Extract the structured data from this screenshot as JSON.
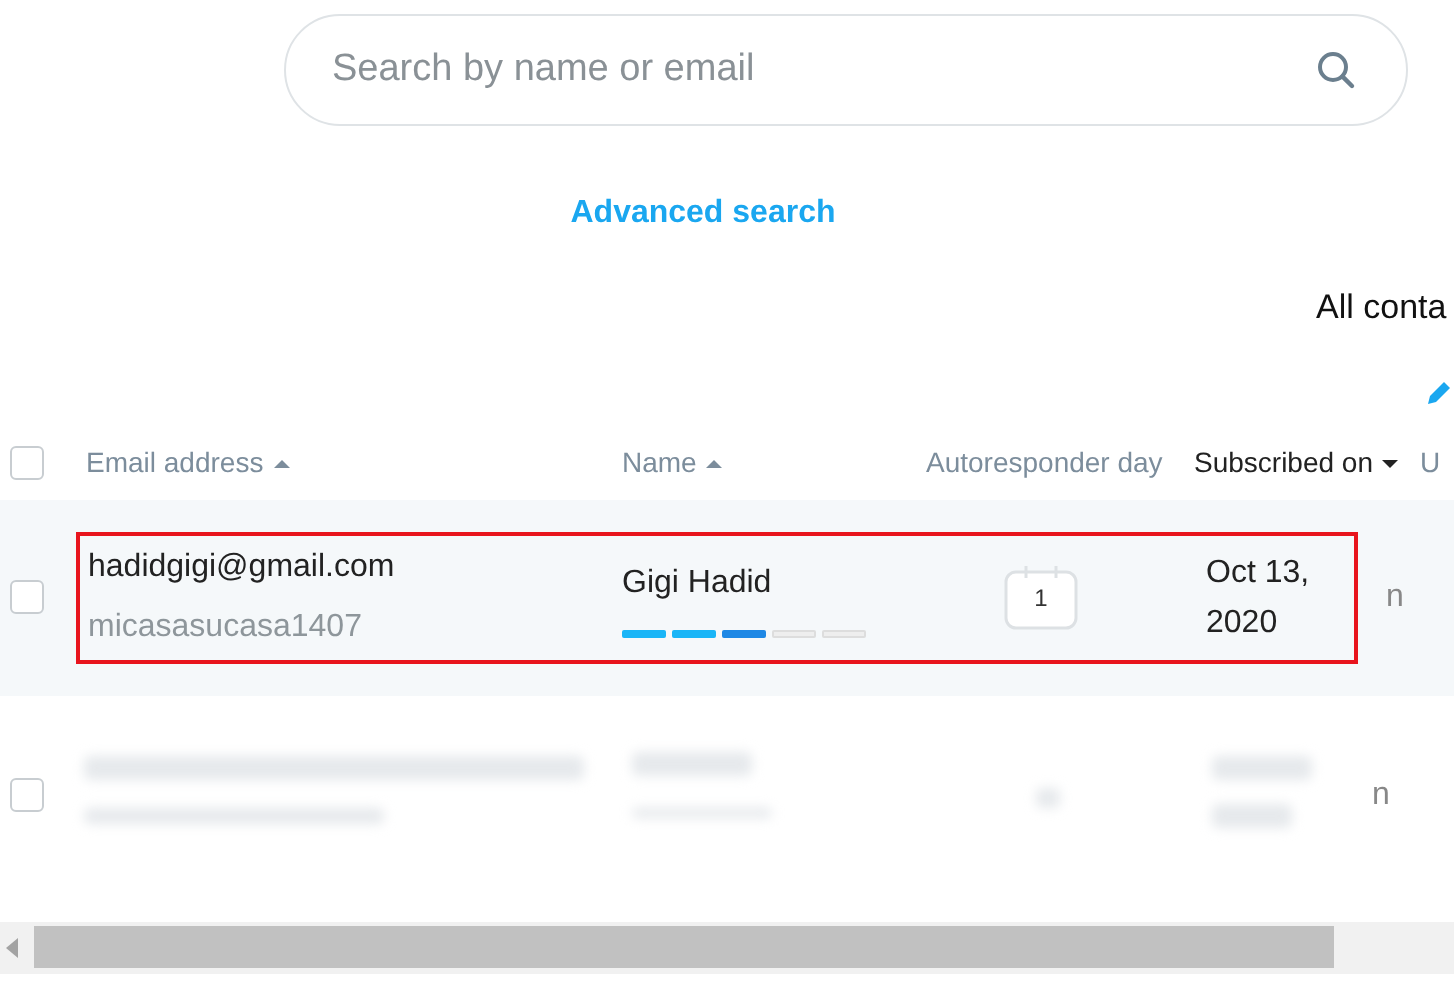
{
  "search": {
    "placeholder": "Search by name or email"
  },
  "advanced_search": "Advanced search",
  "list_title": "All conta",
  "table": {
    "select_all_checked": false,
    "columns": [
      {
        "label": "Email address",
        "sort_indicator": true,
        "sort_descending": false,
        "active": false
      },
      {
        "label": "Name",
        "sort_indicator": true,
        "sort_descending": false,
        "active": false
      },
      {
        "label": "Autoresponder day",
        "sort_indicator": false,
        "active": false
      },
      {
        "label": "Subscribed on",
        "sort_indicator": true,
        "sort_descending": true,
        "active": true
      },
      {
        "label": "U",
        "sort_indicator": false,
        "active": false
      }
    ],
    "rows": [
      {
        "kind": "contact",
        "checked": false,
        "highlighted": true,
        "email": "hadidgigi@gmail.com",
        "username": "micasasucasa1407",
        "name": "Gigi Hadid",
        "level": 0.6,
        "autoresponder_day": "1",
        "subscribed_on": "Oct 13, 2020",
        "column_5": "n"
      },
      {
        "kind": "redacted",
        "checked": false,
        "column_5": "n"
      }
    ]
  }
}
